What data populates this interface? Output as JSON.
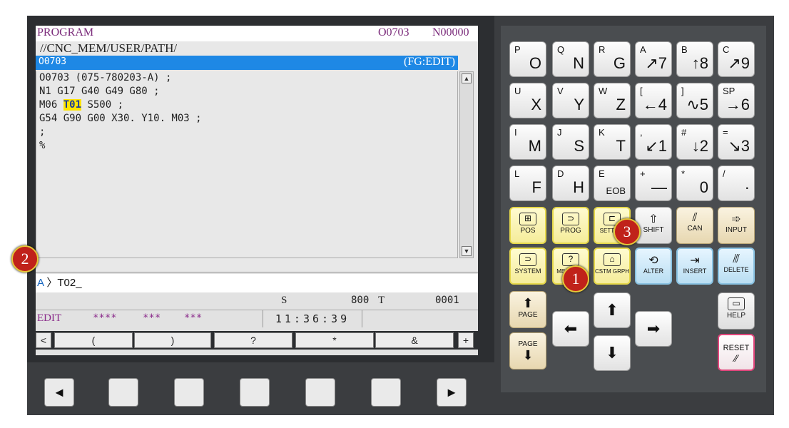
{
  "screen": {
    "title": "PROGRAM",
    "program_no": "O0703",
    "seq_no": "N00000",
    "path": "//CNC_MEM/USER/PATH/",
    "selected_program": "O0703",
    "mode_tag": "(FG:EDIT)",
    "code_lines": [
      "O0703 (075-780203-A) ;",
      "N1 G17 G40 G49 G80 ;",
      "M06 ",
      "T01",
      " S500 ;",
      "G54 G90 G00 X30. Y10. M03 ;",
      ";",
      "%"
    ],
    "input_prefix": "A",
    "input_value": "T02_",
    "spindle_label": "S",
    "spindle_value": "800",
    "tool_label": "T",
    "tool_value": "0001",
    "mode": "EDIT",
    "stars1": "****",
    "stars2": "***",
    "stars3": "***",
    "clock": "11:36:39",
    "softkeys": [
      "<",
      "(",
      ")",
      "?",
      "*",
      "&",
      "+"
    ]
  },
  "function_keys": [
    "◄",
    "",
    "",
    "",
    "",
    "",
    "►"
  ],
  "addr_keys": [
    {
      "tl": "P",
      "br": "O"
    },
    {
      "tl": "Q",
      "br": "N"
    },
    {
      "tl": "R",
      "br": "G"
    },
    {
      "tl": "A",
      "br": "↗7"
    },
    {
      "tl": "B",
      "br": "↑8"
    },
    {
      "tl": "C",
      "br": "↗9"
    },
    {
      "tl": "U",
      "br": "X"
    },
    {
      "tl": "V",
      "br": "Y"
    },
    {
      "tl": "W",
      "br": "Z"
    },
    {
      "tl": "[",
      "br": "←4"
    },
    {
      "tl": "]",
      "br": "∿5"
    },
    {
      "tl": "SP",
      "br": "→6"
    },
    {
      "tl": "I",
      "br": "M"
    },
    {
      "tl": "J",
      "br": "S"
    },
    {
      "tl": "K",
      "br": "T"
    },
    {
      "tl": ",",
      "br": "↙1"
    },
    {
      "tl": "#",
      "br": "↓2"
    },
    {
      "tl": "=",
      "br": "↘3"
    },
    {
      "tl": "L",
      "br": "F"
    },
    {
      "tl": "D",
      "br": "H"
    },
    {
      "tl": "E",
      "br": "EOB"
    },
    {
      "tl": "+",
      "br": "—"
    },
    {
      "tl": "*",
      "br": "0"
    },
    {
      "tl": "/",
      "br": "·"
    }
  ],
  "func_keys_row1": [
    "POS",
    "PROG",
    "SETTING",
    "SHIFT",
    "CAN",
    "INPUT"
  ],
  "func_keys_row2": [
    "SYSTEM",
    "MESSAGE",
    "CSTM GRPH",
    "ALTER",
    "INSERT",
    "DELETE"
  ],
  "nav_keys": {
    "page_up": "PAGE",
    "page_down": "PAGE",
    "help": "HELP",
    "reset": "RESET"
  },
  "markers": [
    "1",
    "2",
    "3"
  ],
  "colors": {
    "purple_text": "#7a2a7a",
    "select_blue": "#1e88e5",
    "highlight_yellow": "#ffe400",
    "marker_red": "#c0221a"
  }
}
